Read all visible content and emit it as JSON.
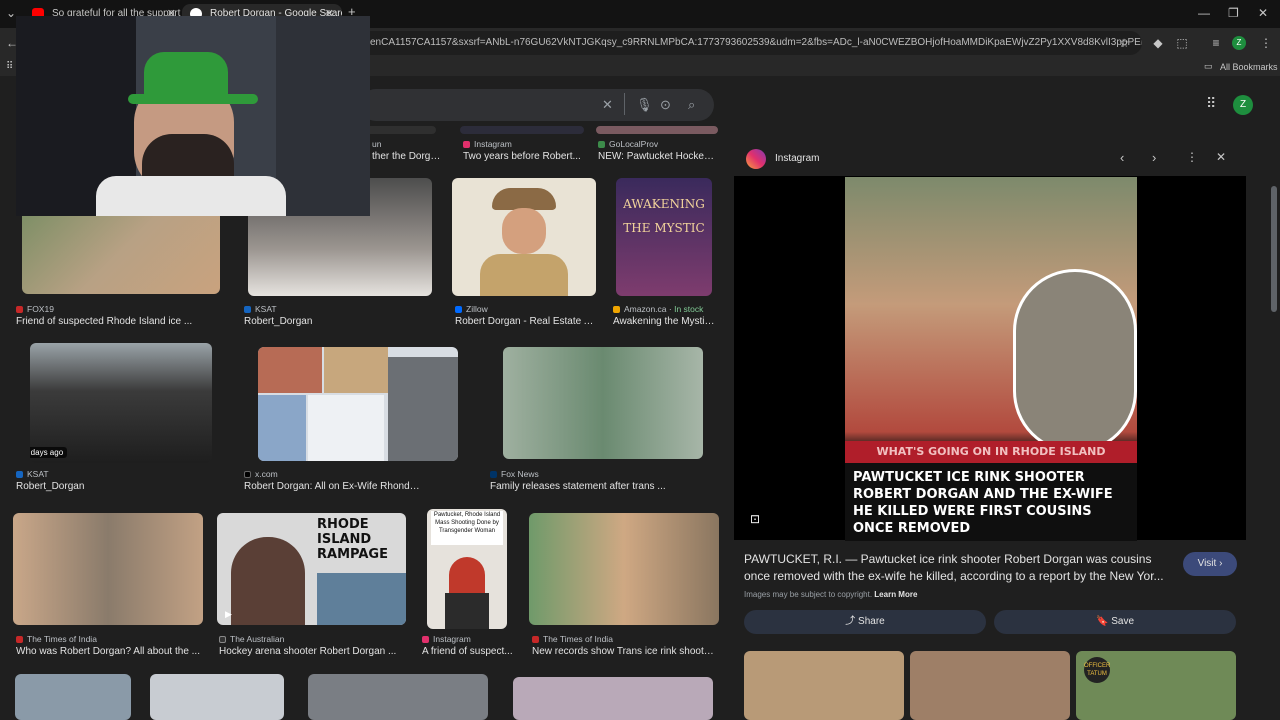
{
  "tabs": [
    {
      "title": "So grateful for all the support",
      "active": false
    },
    {
      "title": "Robert Dorgan - Google Search",
      "active": true
    }
  ],
  "new_tab_label": "+",
  "address_bar": {
    "url": "enCA1157CA1157&sxsrf=ANbL-n76GU62VkNTJGKqsy_c9RRNLMPbCA:1773793602539&udm=2&fbs=ADc_l-aN0CWEZBOHjofHoaMMDiKpaEWjvZ2Py1XXV8d8KvlI3ppPEReeCOS7..."
  },
  "bookmarks": {
    "all_label": "All Bookmarks"
  },
  "profile_initial": "Z",
  "top_row": [
    {
      "source": "un",
      "caption": "ther the Dorga..."
    },
    {
      "source": "Instagram",
      "caption": "Two years before Robert..."
    },
    {
      "source": "GoLocalProv",
      "caption": "NEW: Pawtucket Hockey ..."
    }
  ],
  "row1": [
    {
      "source": "FOX19",
      "caption": "Friend of suspected Rhode Island ice ..."
    },
    {
      "source": "KSAT",
      "caption": "Robert_Dorgan"
    },
    {
      "source": "Zillow",
      "caption": "Robert Dorgan - Real Estate A..."
    },
    {
      "source": "Amazon.ca",
      "stock": "In stock",
      "caption": "Awakening the Mystic...",
      "book_text": "AWAKENING THE MYSTIC"
    }
  ],
  "row2": [
    {
      "source": "KSAT",
      "caption": "Robert_Dorgan",
      "badge": "5 days ago"
    },
    {
      "source": "x.com",
      "caption": "Robert Dorgan: All on Ex-Wife Rhonda ..."
    },
    {
      "source": "Fox News",
      "caption": "Family releases statement after trans ..."
    }
  ],
  "row3": [
    {
      "source": "The Times of India",
      "caption": "Who was Robert Dorgan? All about the ..."
    },
    {
      "source": "The Australian",
      "caption": "Hockey arena shooter Robert Dorgan ...",
      "overlay": "RHODE ISLAND RAMPAGE"
    },
    {
      "source": "Instagram",
      "caption": "A friend of suspect...",
      "overlay": "Pawtucket, Rhode Island Mass Shooting Done by Transgender Woman"
    },
    {
      "source": "The Times of India",
      "caption": "New records show Trans ice rink shooter..."
    }
  ],
  "panel": {
    "source": "Instagram",
    "banner": "WHAT'S GOING ON IN RHODE ISLAND",
    "headline": "PAWTUCKET ICE RINK SHOOTER ROBERT DORGAN AND THE EX-WIFE HE KILLED WERE FIRST COUSINS ONCE REMOVED",
    "title_line1": "PAWTUCKET, R.I. — Pawtucket ice rink shooter Robert Dorgan was cousins",
    "title_line2": "once removed with the ex-wife he killed, according to a report by the New Yor...",
    "visit_label": "Visit",
    "copyright": "Images may be subject to copyright.",
    "learn_more": "Learn More",
    "share_label": "Share",
    "save_label": "Save",
    "related_badge": "OFFICER TATUM"
  },
  "colors": {
    "accent": "#8ab4f8",
    "instagram": "#e1306c",
    "visit_bg": "#3c4a7a",
    "action_bg": "#2b3240"
  }
}
